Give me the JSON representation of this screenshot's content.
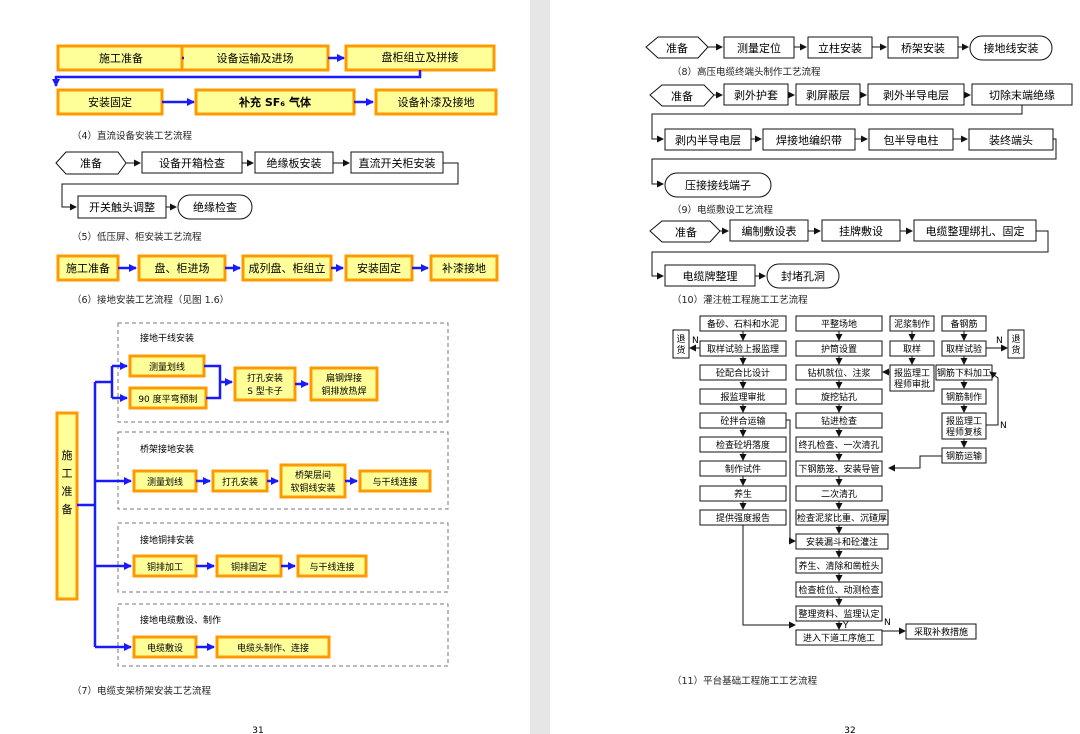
{
  "page31": {
    "f4": {
      "b1": "施工准备",
      "b2": "设备运输及进场",
      "b3": "盘柜组立及拼接",
      "b4": "安装固定",
      "b5": "补充 SF₆ 气体",
      "b6": "设备补漆及接地"
    },
    "cap4": "（4）直流设备安装工艺流程",
    "f5": {
      "b1": "准备",
      "b2": "设备开箱检查",
      "b3": "绝缘板安装",
      "b4": "直流开关柜安装",
      "b5": "开关触头调整",
      "b6": "绝缘检查"
    },
    "cap5": "（5）低压屏、柜安装工艺流程",
    "f6": {
      "b1": "施工准备",
      "b2": "盘、柜进场",
      "b3": "成列盘、柜组立",
      "b4": "安装固定",
      "b5": "补漆接地"
    },
    "cap6": "（6）接地安装工艺流程（见图 1.6）",
    "f7": {
      "start": [
        "施",
        "工",
        "准",
        "备"
      ],
      "g1": {
        "title": "接地干线安装",
        "a": "测量划线",
        "b": "90 度平弯预制",
        "c1": "打孔安装",
        "c2": "S 型卡子",
        "d1": "扁钢焊接",
        "d2": "铜排放热焊"
      },
      "g2": {
        "title": "桥架接地安装",
        "a": "测量划线",
        "b": "打孔安装",
        "c1": "桥架层间",
        "c2": "软铜线安装",
        "d": "与干线连接"
      },
      "g3": {
        "title": "接地铜排安装",
        "a": "铜排加工",
        "b": "铜排固定",
        "c": "与干线连接"
      },
      "g4": {
        "title": "接地电缆敷设、制作",
        "a": "电缆敷设",
        "b": "电缆头制作、连接"
      }
    },
    "cap7": "（7）电缆支架桥架安装工艺流程",
    "page_no": "31"
  },
  "page32": {
    "f8": {
      "b1": "准备",
      "b2": "测量定位",
      "b3": "立柱安装",
      "b4": "桥架安装",
      "b5": "接地线安装"
    },
    "cap8": "（8）高压电缆终端头制作工艺流程",
    "f9": {
      "b1": "准备",
      "b2": "剥外护套",
      "b3": "剥屏蔽层",
      "b4": "剥外半导电层",
      "b5": "切除末端绝缘",
      "b6": "剥内半导电层",
      "b7": "焊接地编织带",
      "b8": "包半导电柱",
      "b9": "装终端头",
      "b10": "压接接线端子"
    },
    "cap9": "（9）电缆敷设工艺流程",
    "f10": {
      "b1": "准备",
      "b2": "编制敷设表",
      "b3": "挂牌敷设",
      "b4": "电缆整理绑扎、固定",
      "b5": "电缆牌整理",
      "b6": "封堵孔洞"
    },
    "cap10": "（10）灌注桩工程施工工艺流程",
    "f11": {
      "c1": [
        "备砂、石料和水泥",
        "取样试验上报监理",
        "砼配合比设计",
        "报监理审批",
        "砼拌合运输",
        "检查砼坍落度",
        "制作试件",
        "养生",
        "提供强度报告"
      ],
      "tui1": [
        "退",
        "货"
      ],
      "n1": "N",
      "n2": "N",
      "c2": [
        "平整场地",
        "护筒设置",
        "钻机就位、注浆",
        "旋挖钻孔",
        "钻进检查",
        "终孔检查、一次清孔",
        "下钢筋笼、安装导管",
        "二次清孔",
        "检查泥浆比重、沉碴厚",
        "安装漏斗和砼灌注",
        "养生、清除和凿桩头",
        "检查桩位、动测检查",
        "整理资料、监理认定",
        "进入下道工序施工"
      ],
      "c3": [
        "泥浆制作",
        "取样",
        "报监理工程师审批"
      ],
      "c4": [
        "备钢筋",
        "取样试验",
        "钢筋下料加工",
        "钢筋制作",
        "报监理工程师复核",
        "钢筋运输"
      ],
      "tui2": [
        "退",
        "货"
      ],
      "remedy": "采取补救措施",
      "n3": "N",
      "y": "Y"
    },
    "cap11": "（11）平台基础工程施工工艺流程",
    "page_no": "32"
  }
}
